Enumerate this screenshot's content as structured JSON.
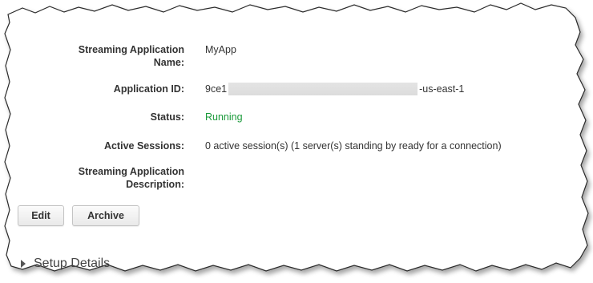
{
  "fields": {
    "name_label_line1": "Streaming Application",
    "name_label_line2": "Name:",
    "name_value": "MyApp",
    "appid_label": "Application ID:",
    "appid_prefix": "9ce1",
    "appid_suffix": "-us-east-1",
    "status_label": "Status:",
    "status_value": "Running",
    "sessions_label": "Active Sessions:",
    "sessions_value": "0 active session(s) (1 server(s) standing by ready for a connection)",
    "desc_label_line1": "Streaming Application",
    "desc_label_line2": "Description:",
    "desc_value": ""
  },
  "buttons": {
    "edit_label": "Edit",
    "archive_label": "Archive"
  },
  "section": {
    "setup_label": "Setup Details"
  },
  "colors": {
    "status_running": "#1a9a3a",
    "label_text": "#333333"
  }
}
